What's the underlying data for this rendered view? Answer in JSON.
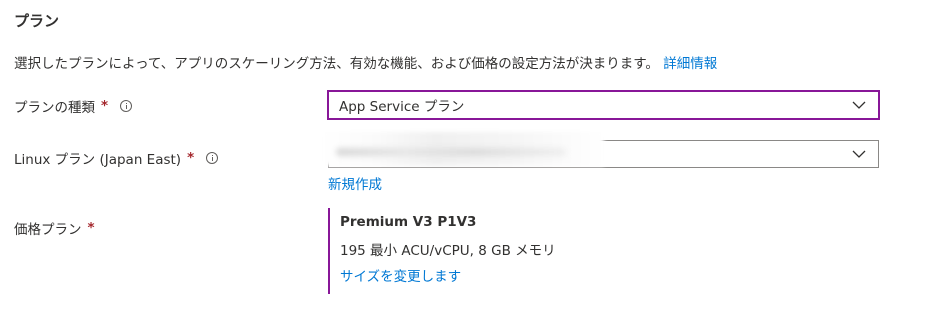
{
  "section": {
    "title": "プラン"
  },
  "description": {
    "text": "選択したプランによって、アプリのスケーリング方法、有効な機能、および価格の設定方法が決まります。",
    "link": "詳細情報"
  },
  "plan_type": {
    "label": "プランの種類",
    "required": "*",
    "selected": "App Service プラン"
  },
  "linux_plan": {
    "label": "Linux プラン (Japan East)",
    "required": "*",
    "selected": "",
    "create_new": "新規作成"
  },
  "pricing_plan": {
    "label": "価格プラン",
    "required": "*",
    "name": "Premium V3 P1V3",
    "spec": "195 最小 ACU/vCPU, 8 GB メモリ",
    "change_size": "サイズを変更します"
  },
  "colors": {
    "accent": "#881798",
    "link": "#0078d4",
    "required": "#a4262c",
    "text": "#323130"
  },
  "icons": {
    "info": "info-icon",
    "dropdown": "chevron-down-icon"
  }
}
